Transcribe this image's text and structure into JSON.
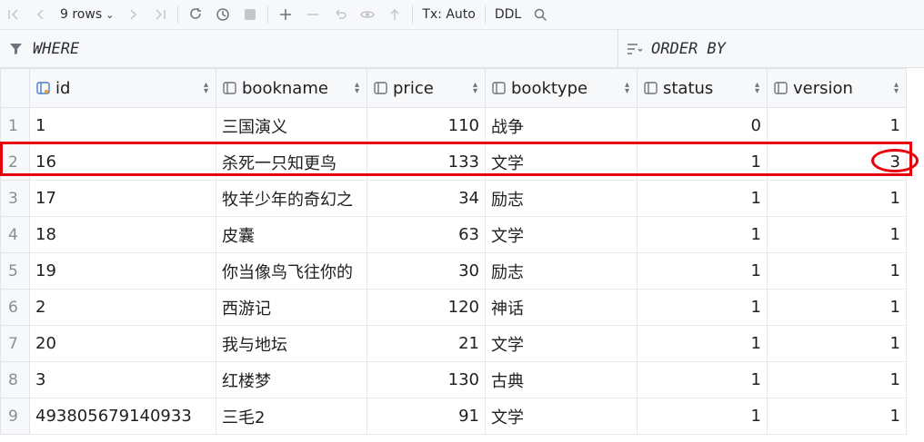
{
  "toolbar": {
    "rows_label": "9 rows",
    "tx_label": "Tx: Auto",
    "ddl_label": "DDL"
  },
  "filters": {
    "where_label": "WHERE",
    "order_label": "ORDER BY"
  },
  "columns": [
    "id",
    "bookname",
    "price",
    "booktype",
    "status",
    "version"
  ],
  "rows": [
    {
      "n": "1",
      "id": "1",
      "bookname": "三国演义",
      "price": "110",
      "booktype": "战争",
      "status": "0",
      "version": "1"
    },
    {
      "n": "2",
      "id": "16",
      "bookname": "杀死一只知更鸟",
      "price": "133",
      "booktype": "文学",
      "status": "1",
      "version": "3"
    },
    {
      "n": "3",
      "id": "17",
      "bookname": "牧羊少年的奇幻之",
      "price": "34",
      "booktype": "励志",
      "status": "1",
      "version": "1"
    },
    {
      "n": "4",
      "id": "18",
      "bookname": "皮囊",
      "price": "63",
      "booktype": "文学",
      "status": "1",
      "version": "1"
    },
    {
      "n": "5",
      "id": "19",
      "bookname": "你当像鸟飞往你的",
      "price": "30",
      "booktype": "励志",
      "status": "1",
      "version": "1"
    },
    {
      "n": "6",
      "id": "2",
      "bookname": "西游记",
      "price": "120",
      "booktype": "神话",
      "status": "1",
      "version": "1"
    },
    {
      "n": "7",
      "id": "20",
      "bookname": "我与地坛",
      "price": "21",
      "booktype": "文学",
      "status": "1",
      "version": "1"
    },
    {
      "n": "8",
      "id": "3",
      "bookname": "红楼梦",
      "price": "130",
      "booktype": "古典",
      "status": "1",
      "version": "1"
    },
    {
      "n": "9",
      "id": "493805679140933",
      "bookname": "三毛2",
      "price": "91",
      "booktype": "文学",
      "status": "1",
      "version": "1"
    }
  ],
  "annotation_color": "#e8000b"
}
